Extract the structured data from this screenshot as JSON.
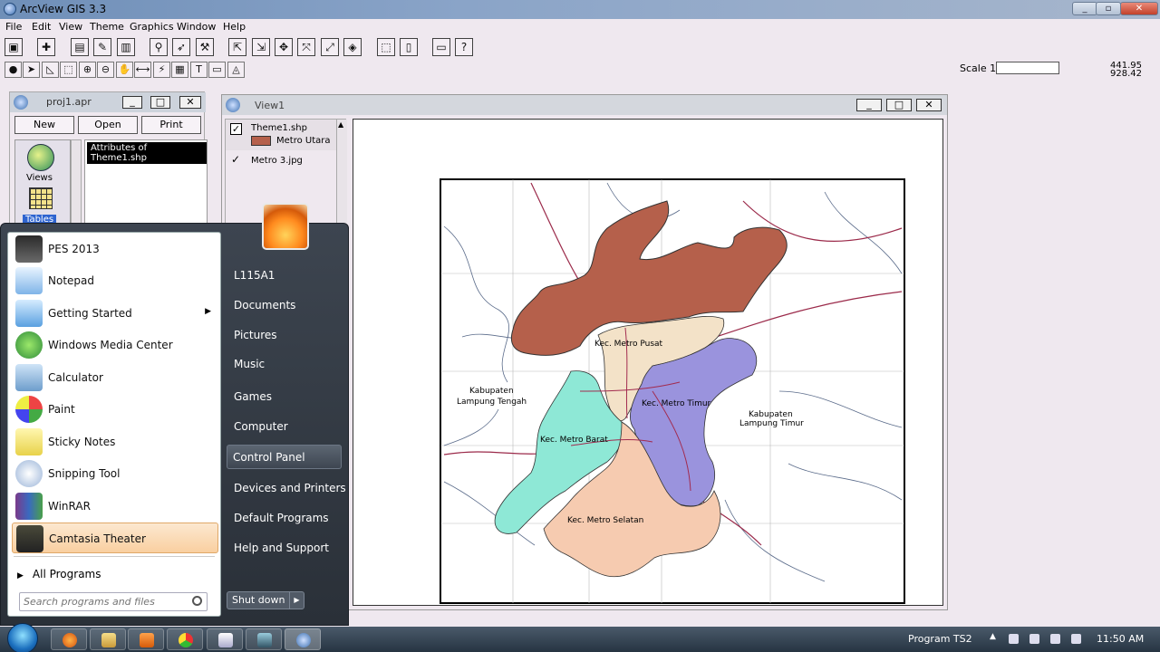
{
  "window": {
    "title": "ArcView GIS 3.3"
  },
  "menu": [
    "File",
    "Edit",
    "View",
    "Theme",
    "Graphics",
    "Window",
    "Help"
  ],
  "scale": {
    "label": "Scale 1:",
    "value": ""
  },
  "coords": {
    "x": "441.95",
    "y": "928.42"
  },
  "project": {
    "title": "proj1.apr",
    "buttons": {
      "new": "New",
      "open": "Open",
      "print": "Print"
    },
    "categories": [
      {
        "label": "Views",
        "icon": "views-icon"
      },
      {
        "label": "Tables",
        "icon": "tables-icon"
      }
    ],
    "selected_doc": "Attributes of Theme1.shp"
  },
  "view": {
    "title": "View1",
    "themes": [
      {
        "name": "Theme1.shp",
        "legend": "Metro Utara",
        "color": "#b5604b",
        "checked": true
      },
      {
        "name": "Metro 3.jpg",
        "checked": true
      }
    ],
    "map_labels": {
      "pusat": "Kec. Metro Pusat",
      "timur": "Kec. Metro Timur",
      "barat": "Kec. Metro Barat",
      "selatan": "Kec. Metro Selatan",
      "kab_tengah_1": "Kabupaten",
      "kab_tengah_2": "Lampung Tengah",
      "kab_timur_1": "Kabupaten",
      "kab_timur_2": "Lampung Timur"
    },
    "colors": {
      "utara": "#b5604b",
      "pusat": "#f3e2c8",
      "timur": "#9a93dd",
      "barat": "#8ee8d6",
      "selatan": "#f6cbb0"
    }
  },
  "start_menu": {
    "programs": [
      {
        "label": "PES 2013",
        "icon": "pes-icon"
      },
      {
        "label": "Notepad",
        "icon": "notepad-icon"
      },
      {
        "label": "Getting Started",
        "icon": "getting-started-icon"
      },
      {
        "label": "Windows Media Center",
        "icon": "media-center-icon"
      },
      {
        "label": "Calculator",
        "icon": "calculator-icon"
      },
      {
        "label": "Paint",
        "icon": "paint-icon"
      },
      {
        "label": "Sticky Notes",
        "icon": "sticky-notes-icon"
      },
      {
        "label": "Snipping Tool",
        "icon": "snipping-tool-icon"
      },
      {
        "label": "WinRAR",
        "icon": "winrar-icon"
      },
      {
        "label": "Camtasia Theater",
        "icon": "camtasia-icon"
      }
    ],
    "all_programs": "All Programs",
    "search_placeholder": "Search programs and files",
    "right": [
      "L115A1",
      "Documents",
      "Pictures",
      "Music",
      "Games",
      "Computer",
      "Control Panel",
      "Devices and Printers",
      "Default Programs",
      "Help and Support"
    ],
    "shutdown": "Shut down"
  },
  "taskbar": {
    "tray_label": "Program TS2",
    "time": "11:50 AM"
  }
}
